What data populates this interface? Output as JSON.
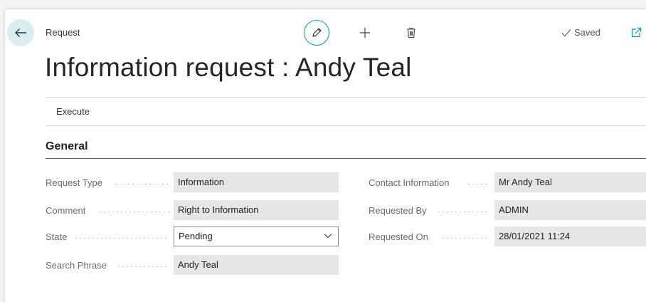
{
  "breadcrumb": "Request",
  "title": "Information request : Andy Teal",
  "toolbar": {
    "saved_label": "Saved"
  },
  "actions": {
    "execute": "Execute"
  },
  "section_title": "General",
  "fields_left": [
    {
      "label": "Request Type",
      "value": "Information"
    },
    {
      "label": "Comment",
      "value": "Right to Information"
    },
    {
      "label": "State",
      "value": "Pending"
    },
    {
      "label": "Search Phrase",
      "value": "Andy Teal"
    }
  ],
  "fields_right": [
    {
      "label": "Contact Information",
      "value": "Mr Andy Teal"
    },
    {
      "label": "Requested By",
      "value": "ADMIN"
    },
    {
      "label": "Requested On",
      "value": "28/01/2021 11:24"
    }
  ],
  "icons": {
    "back": "arrow-left-icon",
    "edit": "pencil-icon",
    "new": "plus-icon",
    "delete": "trash-icon",
    "saved": "checkmark-icon",
    "popout": "open-in-new-window-icon",
    "dropdown": "chevron-down-icon"
  },
  "colors": {
    "accent": "#00a0a8",
    "back_bg": "#d9eef1",
    "field_bg": "#e6e6e6",
    "page_bg": "#f3f3f3"
  }
}
